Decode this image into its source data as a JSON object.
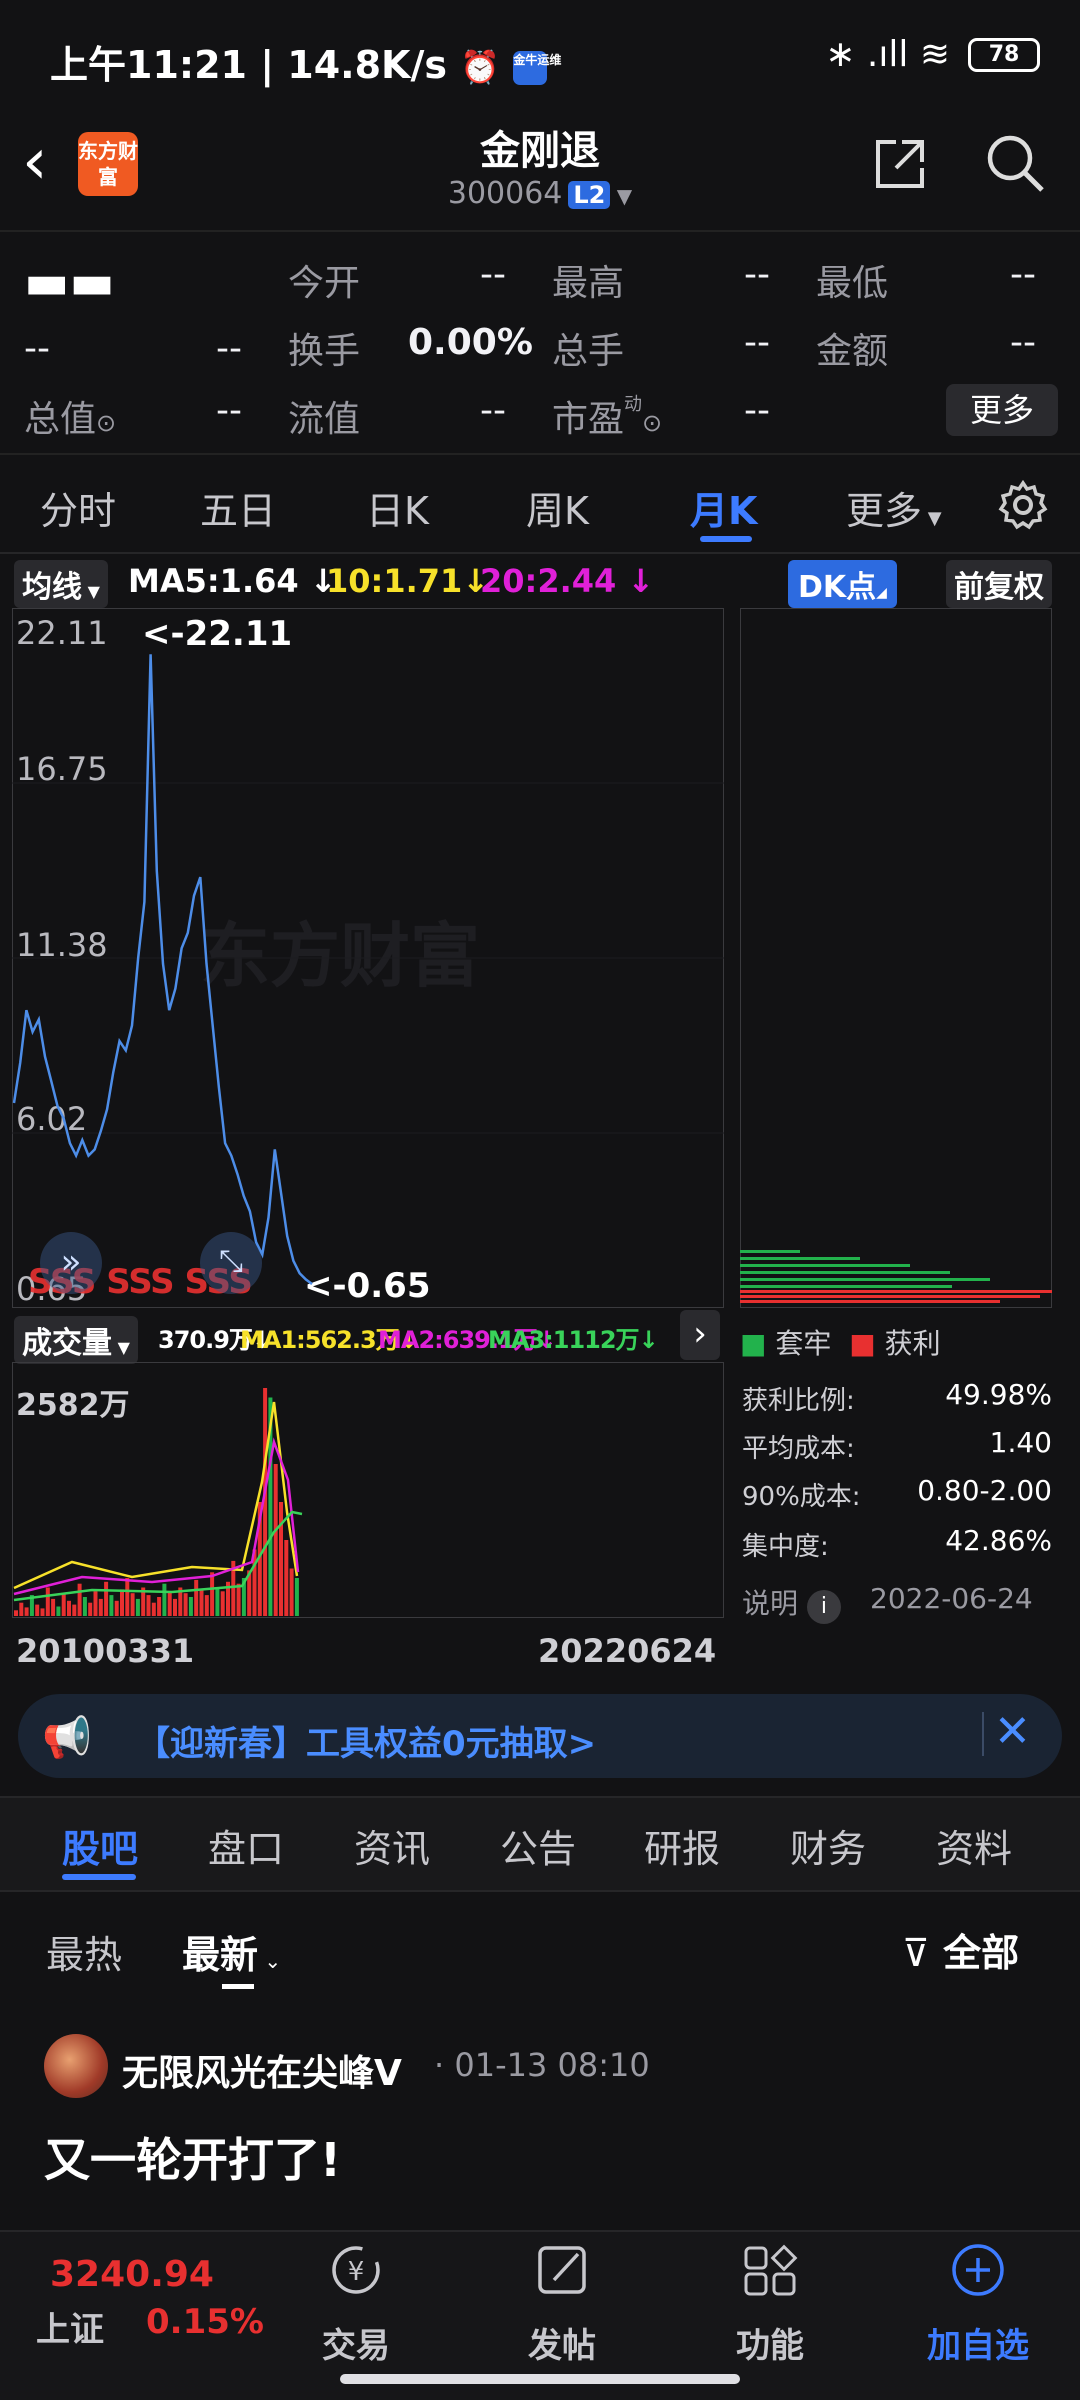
{
  "status_bar": {
    "time": "上午11:21 | 14.8K/s",
    "badge": "金牛运维",
    "signal": "∗ .ıll ≋",
    "battery": "78"
  },
  "header": {
    "back": "‹",
    "logo": "东方财富",
    "title": "金刚退",
    "code": "300064",
    "level": "L2"
  },
  "quote": {
    "price": "▬▬",
    "change": "--",
    "change_pct": "--",
    "rows": [
      {
        "label": "今开",
        "value": "--"
      },
      {
        "label": "最高",
        "value": "--"
      },
      {
        "label": "最低",
        "value": "--"
      },
      {
        "label": "换手",
        "value": "0.00%"
      },
      {
        "label": "总手",
        "value": "--"
      },
      {
        "label": "金额",
        "value": "--"
      },
      {
        "label": "流值",
        "value": "--"
      },
      {
        "label": "市盈",
        "value": "--"
      }
    ],
    "total_value_label": "总值",
    "total_value": "--",
    "more": "更多"
  },
  "kline_tabs": [
    "分时",
    "五日",
    "日K",
    "周K",
    "月K",
    "更多"
  ],
  "ma_bar": {
    "switch": "均线",
    "ma5": "MA5:1.64",
    "ma10": "10:1.71",
    "ma20": "20:2.44",
    "dk": "DK点",
    "adjust": "前复权"
  },
  "chart": {
    "y_ticks": [
      "22.11",
      "16.75",
      "11.38",
      "6.02",
      "0.65"
    ],
    "max_label": "<-22.11",
    "min_label": "<-0.65",
    "watermark": "东方财富",
    "signal_marks": "SSS SSS SSS",
    "volume": {
      "switch": "成交量",
      "vol": "370.9万",
      "ma1": "MA1:562.3万",
      "ma2": "MA2:639.1万",
      "ma3": "MA3:1112万",
      "max": "2582万"
    },
    "dates": [
      "20100331",
      "20220624"
    ]
  },
  "chart_data": {
    "type": "line",
    "title": "",
    "ylim": [
      0.65,
      22.11
    ],
    "x_range": [
      "20100331",
      "20220624"
    ],
    "series": [
      {
        "values": [
          6.5,
          7.8,
          9.5,
          8.8,
          9.2,
          8.0,
          7.2,
          6.4,
          6.0,
          5.2,
          4.8,
          5.3,
          4.8,
          5.0,
          5.6,
          6.3,
          7.5,
          8.5,
          8.2,
          9.0,
          11.2,
          13.0,
          21.0,
          14.0,
          11.0,
          9.5,
          10.2,
          11.5,
          12.0,
          13.2,
          13.8,
          11.0,
          9.0,
          7.0,
          5.2,
          4.8,
          4.2,
          3.5,
          3.0,
          2.0,
          1.6,
          2.8,
          5.0,
          3.6,
          2.2,
          1.4,
          1.0,
          0.8,
          0.65
        ]
      }
    ]
  },
  "chip_panel": {
    "legend": [
      "套牢",
      "获利"
    ],
    "stats": [
      {
        "label": "获利比例:",
        "value": "49.98%"
      },
      {
        "label": "平均成本:",
        "value": "1.40"
      },
      {
        "label": "90%成本:",
        "value": "0.80-2.00"
      },
      {
        "label": "集中度:",
        "value": "42.86%"
      }
    ],
    "note": "说明",
    "date": "2022-06-24"
  },
  "banner": {
    "text": "【迎新春】工具权益0元抽取>"
  },
  "news_tabs": [
    "股吧",
    "盘口",
    "资讯",
    "公告",
    "研报",
    "财务",
    "资料"
  ],
  "sort": {
    "hot": "最热",
    "latest": "最新",
    "filter": "全部"
  },
  "post": {
    "user": "无限风光在尖峰V",
    "time": "· 01-13 08:10",
    "content": "又一轮开打了!"
  },
  "bottom_nav": {
    "index_value": "3240.94",
    "index_name": "上证",
    "index_change": "0.15%",
    "items": [
      "交易",
      "发帖",
      "功能",
      "加自选"
    ]
  },
  "colors": {
    "accent": "#3d7bff",
    "up": "#e83030",
    "down": "#22b24c",
    "line": "#4d8de8"
  }
}
